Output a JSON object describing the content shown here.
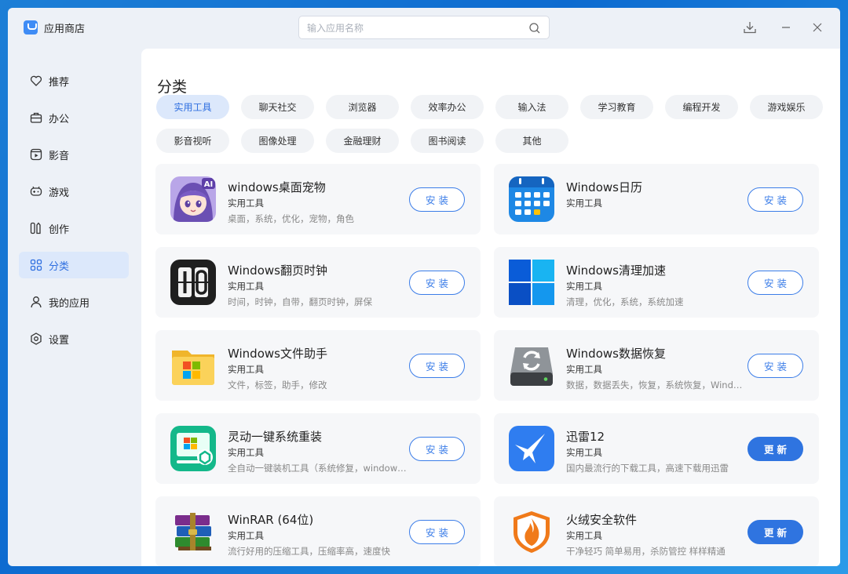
{
  "app": {
    "title": "应用商店"
  },
  "search": {
    "placeholder": "输入应用名称",
    "value": ""
  },
  "titlebar": {
    "icons": [
      "download-icon",
      "minimize-icon",
      "close-icon"
    ]
  },
  "sidebar": {
    "items": [
      {
        "label": "推荐",
        "icon": "heart-icon",
        "active": false
      },
      {
        "label": "办公",
        "icon": "briefcase-icon",
        "active": false
      },
      {
        "label": "影音",
        "icon": "media-icon",
        "active": false
      },
      {
        "label": "游戏",
        "icon": "gamepad-icon",
        "active": false
      },
      {
        "label": "创作",
        "icon": "create-icon",
        "active": false
      },
      {
        "label": "分类",
        "icon": "grid-icon",
        "active": true
      },
      {
        "label": "我的应用",
        "icon": "user-icon",
        "active": false
      },
      {
        "label": "设置",
        "icon": "settings-icon",
        "active": false
      }
    ]
  },
  "main": {
    "title": "分类",
    "categories": [
      "实用工具",
      "聊天社交",
      "浏览器",
      "效率办公",
      "输入法",
      "学习教育",
      "编程开发",
      "游戏娱乐",
      "影音视听",
      "图像处理",
      "金融理财",
      "图书阅读",
      "其他"
    ],
    "active_category": "实用工具",
    "apps": [
      {
        "name": "windows桌面宠物",
        "category": "实用工具",
        "tags": "桌面，系统，优化，宠物，角色",
        "action": "安装",
        "icon": "desktop-pet-icon"
      },
      {
        "name": "Windows日历",
        "category": "实用工具",
        "tags": "",
        "action": "安装",
        "icon": "calendar-icon"
      },
      {
        "name": "Windows翻页时钟",
        "category": "实用工具",
        "tags": "时间，时钟，自带，翻页时钟，屏保",
        "action": "安装",
        "icon": "flip-clock-icon"
      },
      {
        "name": "Windows清理加速",
        "category": "实用工具",
        "tags": "清理，优化，系统，系统加速",
        "action": "安装",
        "icon": "windows-logo-icon"
      },
      {
        "name": "Windows文件助手",
        "category": "实用工具",
        "tags": "文件，标签，助手，修改",
        "action": "安装",
        "icon": "folder-icon"
      },
      {
        "name": "Windows数据恢复",
        "category": "实用工具",
        "tags": "数据，数据丢失，恢复，系统恢复，Wind…",
        "action": "安装",
        "icon": "disk-recovery-icon"
      },
      {
        "name": "灵动一键系统重装",
        "category": "实用工具",
        "tags": "全自动一键装机工具（系统修复，window…",
        "action": "安装",
        "icon": "system-reinstall-icon"
      },
      {
        "name": "迅雷12",
        "category": "实用工具",
        "tags": "国内最流行的下载工具，高速下载用迅雷",
        "action": "更新",
        "icon": "xunlei-bird-icon"
      },
      {
        "name": "WinRAR (64位)",
        "category": "实用工具",
        "tags": "流行好用的压缩工具，压缩率高，速度快",
        "action": "安装",
        "icon": "winrar-books-icon"
      },
      {
        "name": "火绒安全软件",
        "category": "实用工具",
        "tags": "干净轻巧 简单易用，杀防管控 样样精通",
        "action": "更新",
        "icon": "huorong-shield-icon"
      }
    ]
  },
  "colors": {
    "accent": "#2f74e0",
    "active_bg": "#dce8fb",
    "card_bg": "#f6f7f9",
    "sidebar_bg": "#edf1f7"
  }
}
